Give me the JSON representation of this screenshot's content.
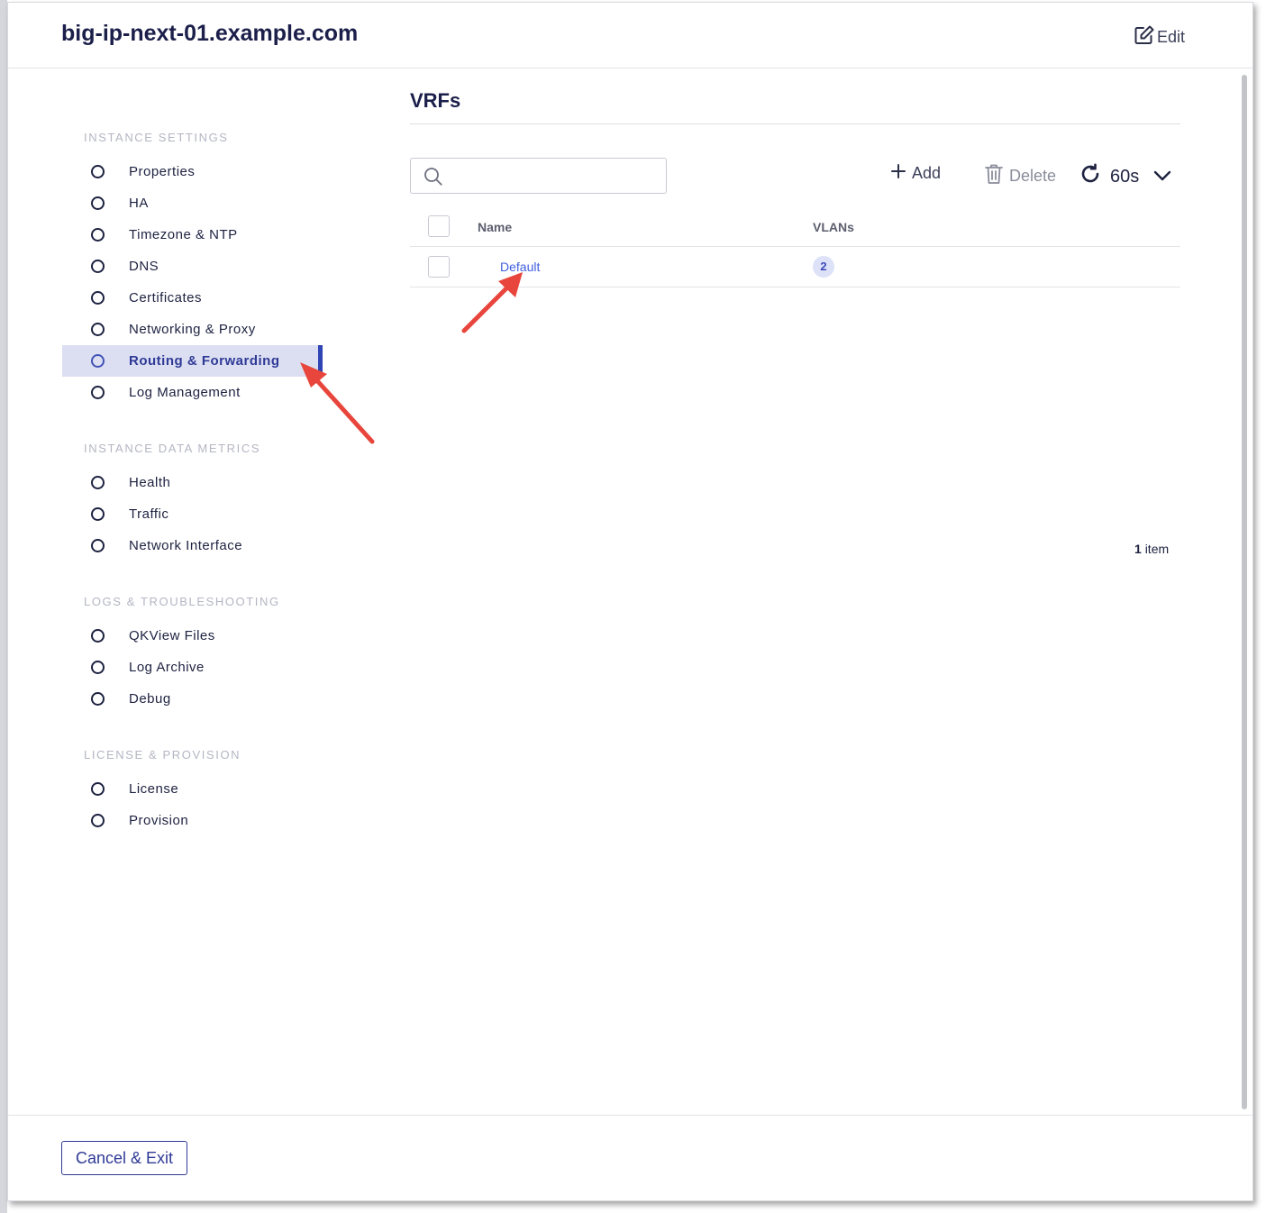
{
  "header": {
    "title": "big-ip-next-01.example.com",
    "edit_label": "Edit"
  },
  "sidebar": {
    "sections": [
      {
        "label": "INSTANCE SETTINGS",
        "items": [
          {
            "label": "Properties"
          },
          {
            "label": "HA"
          },
          {
            "label": "Timezone & NTP"
          },
          {
            "label": "DNS"
          },
          {
            "label": "Certificates"
          },
          {
            "label": "Networking & Proxy"
          },
          {
            "label": "Routing & Forwarding",
            "active": true
          },
          {
            "label": "Log Management"
          }
        ]
      },
      {
        "label": "INSTANCE DATA METRICS",
        "items": [
          {
            "label": "Health"
          },
          {
            "label": "Traffic"
          },
          {
            "label": "Network Interface"
          }
        ]
      },
      {
        "label": "LOGS & TROUBLESHOOTING",
        "items": [
          {
            "label": "QKView Files"
          },
          {
            "label": "Log Archive"
          },
          {
            "label": "Debug"
          }
        ]
      },
      {
        "label": "LICENSE & PROVISION",
        "items": [
          {
            "label": "License"
          },
          {
            "label": "Provision"
          }
        ]
      }
    ]
  },
  "main": {
    "title": "VRFs",
    "search": {
      "value": "",
      "placeholder": ""
    },
    "toolbar": {
      "add_label": "Add",
      "delete_label": "Delete",
      "refresh_interval": "60s"
    },
    "table": {
      "columns": [
        "Name",
        "VLANs"
      ],
      "rows": [
        {
          "name": "Default",
          "vlans": "2"
        }
      ]
    },
    "item_count": "1",
    "item_count_unit": "item"
  },
  "footer": {
    "cancel_label": "Cancel & Exit"
  },
  "colors": {
    "accent": "#2f44b5",
    "active_bg": "#dcdff2",
    "link": "#4060e0",
    "annotation_arrow": "#e8463c"
  }
}
